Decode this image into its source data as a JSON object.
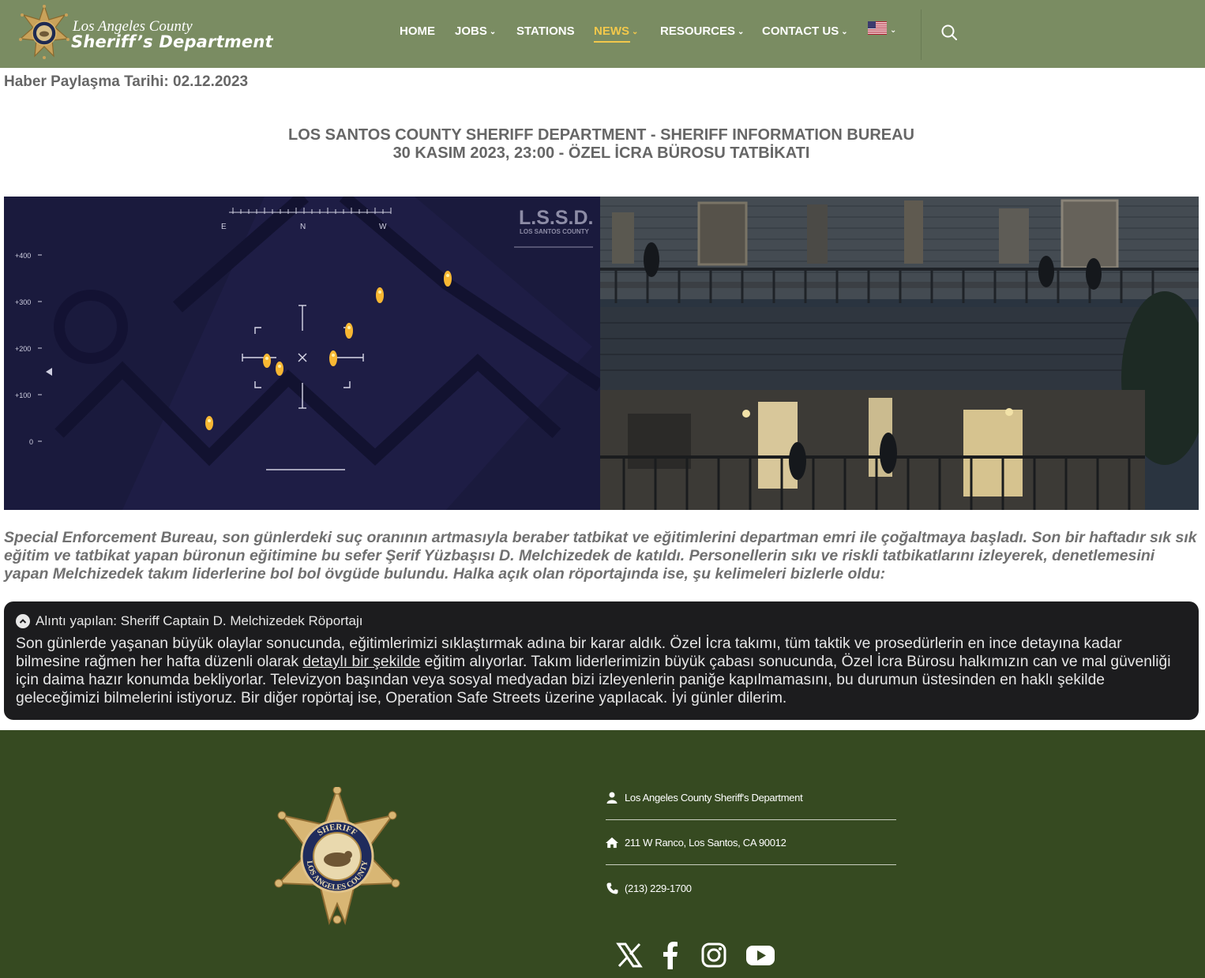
{
  "header": {
    "logo": {
      "line1": "Los Angeles County",
      "line2": "Sheriff’s Department"
    },
    "nav": [
      {
        "label": "HOME",
        "has_dropdown": false,
        "active": false
      },
      {
        "label": "JOBS",
        "has_dropdown": true,
        "active": false
      },
      {
        "label": "STATIONS",
        "has_dropdown": false,
        "active": false
      },
      {
        "label": "NEWS",
        "has_dropdown": true,
        "active": true
      },
      {
        "label": "RESOURCES",
        "has_dropdown": true,
        "active": false
      },
      {
        "label": "CONTACT US",
        "has_dropdown": true,
        "active": false
      }
    ],
    "language_icon": "us-flag-icon",
    "search_icon": "search-icon",
    "colors": {
      "background": "#7a8c62",
      "active": "#f2c84b"
    }
  },
  "article": {
    "date_line": "Haber Paylaşma Tarihi: 02.12.2023",
    "title_line1": "LOS SANTOS COUNTY SHERIFF DEPARTMENT - SHERIFF INFORMATION BUREAU",
    "title_line2": "30 KASIM 2023, 23:00 - ÖZEL İCRA BÜROSU TATBİKATI",
    "hero": {
      "thermal_overlay": {
        "compass": [
          "E",
          "N",
          "W"
        ],
        "scale": [
          "+400",
          "+300",
          "+200",
          "+100",
          "0"
        ],
        "watermark_title": "L.S.S.D.",
        "watermark_sub": "LOS SANTOS COUNTY"
      }
    },
    "intro": "Special Enforcement Bureau, son günlerdeki suç oranının artmasıyla beraber tatbikat ve eğitimlerini departman emri ile çoğaltmaya başladı. Son bir haftadır sık sık eğitim ve tatbikat yapan büronun eğitimine bu sefer Şerif Yüzbaşısı D. Melchizedek de katıldı. Personellerin sıkı ve riskli tatbikatlarını izleyerek, denetlemesini yapan Melchizedek takım liderlerine bol bol övgüde bulundu. Halka açık olan röportajında ise, şu kelimeleri bizlerle oldu:",
    "quote": {
      "title": "Alıntı yapılan: Sheriff Captain D. Melchizedek Röportajı",
      "body_before": "Son günlerde yaşanan büyük olaylar sonucunda, eğitimlerimizi sıklaştırmak adına bir karar aldık. Özel İcra takımı, tüm taktik ve prosedürlerin en ince detayına kadar bilmesine rağmen her hafta düzenli olarak ",
      "link": "detaylı bir şekilde",
      "body_after": " eğitim alıyorlar. Takım liderlerimizin büyük çabası sonucunda, Özel İcra Bürosu halkımızın can ve mal güvenliği için daima hazır konumda bekliyorlar. Televizyon başından veya sosyal medyadan bizi izleyenlerin paniğe kapılmamasını, bu durumun üstesinden en haklı şekilde geleceğimizi bilmelerini istiyoruz. Bir diğer ropörtaj ise, Operation Safe Streets üzerine yapılacak. İyi günler dilerim."
    }
  },
  "footer": {
    "name": "Los Angeles County Sheriff's Department",
    "address": "211 W Ranco, Los Santos, CA 90012",
    "phone": "(213) 229-1700",
    "badge_text": {
      "top": "SHERIFF",
      "bottom": "LOS ANGELES COUNTY"
    },
    "social": [
      "x-icon",
      "facebook-icon",
      "instagram-icon",
      "youtube-icon"
    ],
    "colors": {
      "background": "#364a21"
    }
  }
}
